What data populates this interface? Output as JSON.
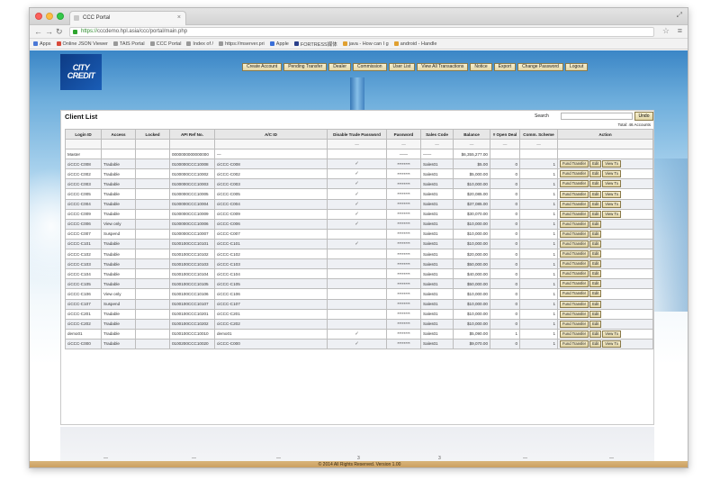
{
  "browser": {
    "tab_title": "CCC Portal",
    "url_secure": "https://",
    "url_rest": "cccdemo.hpl.asia/ccc/portal/main.php",
    "bookmarks": [
      "Apps",
      "Online JSON Viewer",
      "TAIS Portal",
      "CCC Portal",
      "Index of /",
      "https://mserver.pri",
      "Apple",
      "FORTRESS媒体",
      "java - How can I g",
      "android - Handle"
    ]
  },
  "header": {
    "logo_line1": "CITY",
    "logo_line2": "CREDIT",
    "nav_buttons": [
      "Create Account",
      "Pending Transfer",
      "Dealer",
      "Commission",
      "User List",
      "View All Transactions",
      "Notice",
      "Export",
      "Change Password",
      "Logout"
    ]
  },
  "panel": {
    "title": "Client List",
    "search_label": "Search",
    "undo_label": "Undo",
    "total_label": "Total: 46 Accounts"
  },
  "table": {
    "columns": [
      "Login ID",
      "Access",
      "Locked",
      "API Ref No.",
      "A/C ID",
      "Disable Trade Password",
      "Password",
      "Sales Code",
      "Balance",
      "# Open Deal",
      "Comm. Scheme",
      "Action"
    ],
    "filter_marks": [
      "",
      "",
      "",
      "",
      "",
      "—",
      "—",
      "—",
      "—",
      "—",
      "—",
      ""
    ],
    "actions": [
      "Fund Transfer",
      "Edit",
      "View Tx"
    ],
    "rows": [
      {
        "login": "Master",
        "access": "",
        "locked": "",
        "api": "0000000000000000",
        "acid": "—",
        "dtp": "",
        "pw": "——",
        "sales": "——",
        "balance": "$6,355,277.00",
        "deals": "",
        "scheme": "",
        "actions": 0
      },
      {
        "login": "ciCCC-C008",
        "access": "Tradable",
        "locked": "",
        "api": "0100000CCC10008",
        "acid": "ciCCC-C008",
        "dtp": "✓",
        "pw": "********",
        "sales": "Sales01",
        "balance": "$5.00",
        "deals": "0",
        "scheme": "1",
        "actions": 3
      },
      {
        "login": "ciCCC-C002",
        "access": "Tradable",
        "locked": "",
        "api": "0100000CCC10002",
        "acid": "ciCCC-C002",
        "dtp": "✓",
        "pw": "********",
        "sales": "Sales01",
        "balance": "$5,000.00",
        "deals": "0",
        "scheme": "1",
        "actions": 3
      },
      {
        "login": "ciCCC-C003",
        "access": "Tradable",
        "locked": "",
        "api": "0100000CCC10003",
        "acid": "ciCCC-C003",
        "dtp": "✓",
        "pw": "********",
        "sales": "Sales01",
        "balance": "$10,000.00",
        "deals": "0",
        "scheme": "1",
        "actions": 3
      },
      {
        "login": "ciCCC-C005",
        "access": "Tradable",
        "locked": "",
        "api": "0100000CCC10005",
        "acid": "ciCCC-C005",
        "dtp": "✓",
        "pw": "********",
        "sales": "Sales01",
        "balance": "$20,085.00",
        "deals": "0",
        "scheme": "1",
        "actions": 3
      },
      {
        "login": "ciCCC-C004",
        "access": "Tradable",
        "locked": "",
        "api": "0100000CCC10004",
        "acid": "ciCCC-C004",
        "dtp": "✓",
        "pw": "********",
        "sales": "Sales01",
        "balance": "$37,085.00",
        "deals": "0",
        "scheme": "1",
        "actions": 3
      },
      {
        "login": "ciCCC-C009",
        "access": "Tradable",
        "locked": "",
        "api": "0100000CCC10009",
        "acid": "ciCCC-C009",
        "dtp": "✓",
        "pw": "********",
        "sales": "Sales01",
        "balance": "$30,070.00",
        "deals": "0",
        "scheme": "1",
        "actions": 3
      },
      {
        "login": "ciCCC-C006",
        "access": "View only",
        "locked": "",
        "api": "0100000CCC10006",
        "acid": "ciCCC-C006",
        "dtp": "✓",
        "pw": "********",
        "sales": "Sales01",
        "balance": "$10,000.00",
        "deals": "0",
        "scheme": "1",
        "actions": 2
      },
      {
        "login": "ciCCC-C007",
        "access": "Suspend",
        "locked": "",
        "api": "0100000CCC10007",
        "acid": "ciCCC-C007",
        "dtp": "",
        "pw": "********",
        "sales": "Sales01",
        "balance": "$10,000.00",
        "deals": "0",
        "scheme": "1",
        "actions": 2
      },
      {
        "login": "ciCCC-C101",
        "access": "Tradable",
        "locked": "",
        "api": "0100100CCC10101",
        "acid": "ciCCC-C101",
        "dtp": "✓",
        "pw": "********",
        "sales": "Sales01",
        "balance": "$10,000.00",
        "deals": "0",
        "scheme": "1",
        "actions": 2
      },
      {
        "login": "ciCCC-C102",
        "access": "Tradable",
        "locked": "",
        "api": "0100100CCC10102",
        "acid": "ciCCC-C102",
        "dtp": "",
        "pw": "********",
        "sales": "Sales01",
        "balance": "$20,000.00",
        "deals": "0",
        "scheme": "1",
        "actions": 2
      },
      {
        "login": "ciCCC-C103",
        "access": "Tradable",
        "locked": "",
        "api": "0100100CCC10103",
        "acid": "ciCCC-C103",
        "dtp": "",
        "pw": "********",
        "sales": "Sales01",
        "balance": "$50,000.00",
        "deals": "0",
        "scheme": "1",
        "actions": 2
      },
      {
        "login": "ciCCC-C104",
        "access": "Tradable",
        "locked": "",
        "api": "0100100CCC10104",
        "acid": "ciCCC-C104",
        "dtp": "",
        "pw": "********",
        "sales": "Sales01",
        "balance": "$40,000.00",
        "deals": "0",
        "scheme": "1",
        "actions": 2
      },
      {
        "login": "ciCCC-C105",
        "access": "Tradable",
        "locked": "",
        "api": "0100100CCC10105",
        "acid": "ciCCC-C105",
        "dtp": "",
        "pw": "********",
        "sales": "Sales01",
        "balance": "$50,000.00",
        "deals": "0",
        "scheme": "1",
        "actions": 2
      },
      {
        "login": "ciCCC-C106",
        "access": "View only",
        "locked": "",
        "api": "0100100CCC10106",
        "acid": "ciCCC-C106",
        "dtp": "",
        "pw": "********",
        "sales": "Sales01",
        "balance": "$10,000.00",
        "deals": "0",
        "scheme": "1",
        "actions": 2
      },
      {
        "login": "ciCCC-C107",
        "access": "Suspend",
        "locked": "",
        "api": "0100100CCC10107",
        "acid": "ciCCC-C107",
        "dtp": "",
        "pw": "********",
        "sales": "Sales01",
        "balance": "$10,000.00",
        "deals": "0",
        "scheme": "1",
        "actions": 2
      },
      {
        "login": "ciCCC-C201",
        "access": "Tradable",
        "locked": "",
        "api": "0100100CCC10201",
        "acid": "ciCCC-C201",
        "dtp": "",
        "pw": "********",
        "sales": "Sales01",
        "balance": "$10,000.00",
        "deals": "0",
        "scheme": "1",
        "actions": 2
      },
      {
        "login": "ciCCC-C202",
        "access": "Tradable",
        "locked": "",
        "api": "0100100CCC10202",
        "acid": "ciCCC-C202",
        "dtp": "",
        "pw": "********",
        "sales": "Sales01",
        "balance": "$10,000.00",
        "deals": "0",
        "scheme": "1",
        "actions": 2
      },
      {
        "login": "demo01",
        "access": "Tradable",
        "locked": "",
        "api": "0100100CCC10010",
        "acid": "demo01",
        "dtp": "✓",
        "pw": "********",
        "sales": "Sales01",
        "balance": "$5,090.00",
        "deals": "1",
        "scheme": "1",
        "actions": 3
      },
      {
        "login": "ciCCC-C000",
        "access": "Tradable",
        "locked": "",
        "api": "0100200CCC10020",
        "acid": "ciCCC-C000",
        "dtp": "✓",
        "pw": "********",
        "sales": "Sales01",
        "balance": "$9,070.00",
        "deals": "0",
        "scheme": "1",
        "actions": 3
      }
    ]
  },
  "pager": [
    "—",
    "—",
    "—",
    "3",
    "3",
    "—",
    "—"
  ],
  "footer": "© 2014 All Rights Reserved. Version 1.00"
}
